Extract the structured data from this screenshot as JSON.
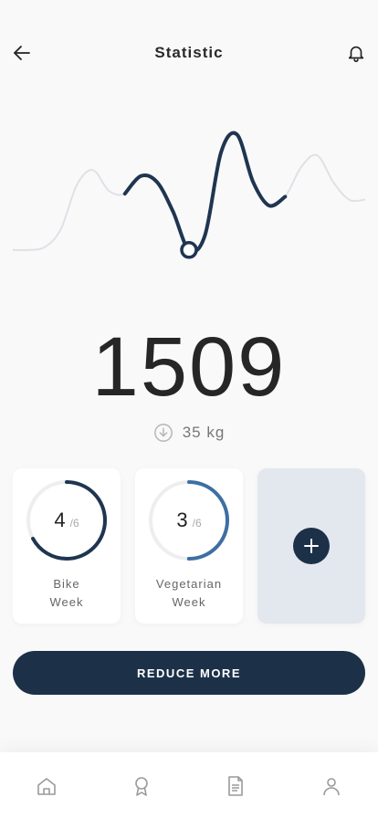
{
  "header": {
    "title": "Statistic",
    "back_icon": "arrow-left-icon",
    "notification_icon": "bell-icon"
  },
  "chart_data": {
    "type": "line",
    "title": "",
    "xlabel": "",
    "ylabel": "",
    "series": [
      {
        "values": [
          5,
          5,
          6,
          12,
          27,
          32,
          25,
          24,
          30,
          28,
          18,
          5,
          10,
          38,
          44,
          28,
          20,
          23,
          33,
          37,
          28,
          22,
          22
        ]
      }
    ],
    "highlight_range": [
      7,
      17
    ],
    "marker_index": 11,
    "ylim": [
      0,
      50
    ],
    "grid": false,
    "colors": {
      "base": "#dfe1e6",
      "highlight": "#1f3550"
    }
  },
  "stats": {
    "value": "1509",
    "weight": "35 kg",
    "weight_icon": "arrow-down-circle-icon"
  },
  "cards": [
    {
      "count": "4",
      "total": "/6",
      "label_line1": "Bike",
      "label_line2": "Week",
      "progress": 0.67,
      "color": "#1f3550"
    },
    {
      "count": "3",
      "total": "/6",
      "label_line1": "Vegetarian",
      "label_line2": "Week",
      "progress": 0.5,
      "color": "#3d6fa3"
    }
  ],
  "add_card": {
    "icon": "plus-icon"
  },
  "cta": {
    "label": "REDUCE MORE"
  },
  "nav": [
    {
      "icon": "home-icon"
    },
    {
      "icon": "award-icon"
    },
    {
      "icon": "document-icon"
    },
    {
      "icon": "profile-icon"
    }
  ]
}
